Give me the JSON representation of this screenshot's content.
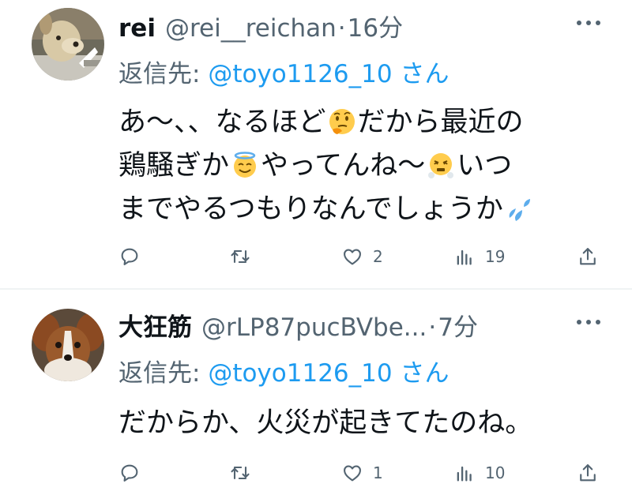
{
  "tweets": [
    {
      "name": "rei",
      "handle": "@rei__reichan",
      "separator": "·",
      "time": "16分",
      "reply_prefix": "返信先: ",
      "reply_mention": "@toyo1126_10",
      "reply_suffix": " さん",
      "text_lines": [
        [
          "あ〜、、なるほど",
          "だから最近の"
        ],
        [
          "鶏騒ぎか",
          "やってんね〜",
          "いつ"
        ],
        [
          "までやるつもりなんでしょうか",
          ""
        ]
      ],
      "emojis": [
        "thinking-face",
        "smiling-face-with-halo",
        "face-with-steam-from-nose",
        "sweat-droplets"
      ],
      "counts": {
        "replies": "",
        "retweets": "",
        "likes": "2",
        "views": "19"
      }
    },
    {
      "name": "大狂筋",
      "handle": "@rLP87pucBVbe...",
      "separator": "·",
      "time": "7分",
      "reply_prefix": "返信先: ",
      "reply_mention": "@toyo1126_10",
      "reply_suffix": " さん",
      "text_lines": [
        [
          "だからか、火災が起きてたのね。"
        ]
      ],
      "counts": {
        "replies": "",
        "retweets": "",
        "likes": "1",
        "views": "10"
      }
    }
  ],
  "colors": {
    "text": "#0f1419",
    "secondary": "#536471",
    "accent": "#1d9bf0",
    "divider": "#eff3f4"
  },
  "icons": [
    "more-icon",
    "reply-icon",
    "retweet-icon",
    "like-icon",
    "views-icon",
    "share-icon"
  ]
}
